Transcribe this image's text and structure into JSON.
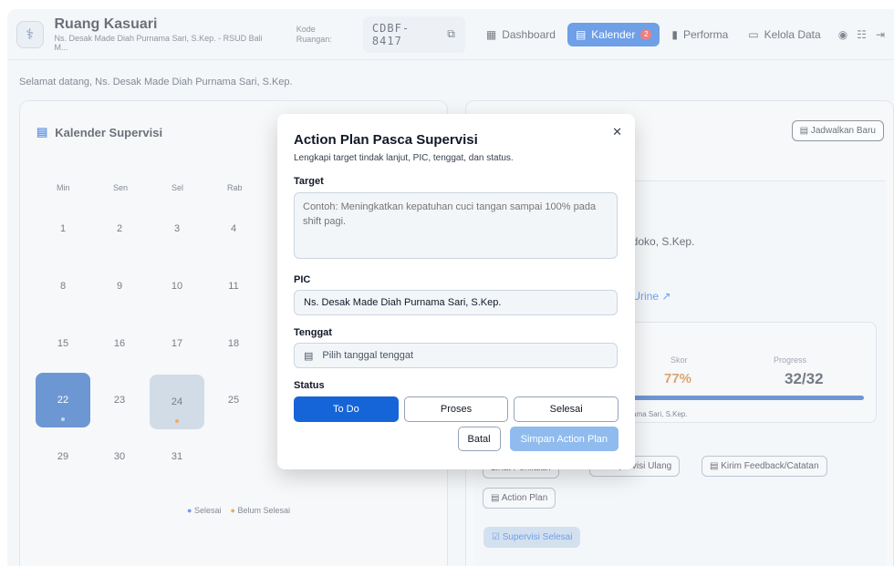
{
  "header": {
    "title": "Ruang Kasuari",
    "subtitle": "Ns. Desak Made Diah Purnama Sari, S.Kep. - RSUD Bali M...",
    "kode_label": "Kode Ruangan:",
    "kode_value": "CDBF-8417",
    "nav": [
      {
        "label": "Dashboard",
        "icon": "dashboard-icon"
      },
      {
        "label": "Kalender",
        "icon": "calendar-icon",
        "badge": "2"
      },
      {
        "label": "Performa",
        "icon": "chart-icon"
      },
      {
        "label": "Kelola Data",
        "icon": "database-icon"
      }
    ]
  },
  "welcome": "Selamat datang, Ns. Desak Made Diah Purnama Sari, S.Kep.",
  "calendar": {
    "title": "Kalender Supervisi",
    "days_of_week": [
      "Min",
      "Sen",
      "Sel",
      "Rab"
    ],
    "weeks": [
      [
        "1",
        "2",
        "3",
        "4"
      ],
      [
        "8",
        "9",
        "10",
        "11"
      ],
      [
        "15",
        "16",
        "17",
        "18"
      ],
      [
        "22",
        "23",
        "24",
        "25"
      ],
      [
        "29",
        "30",
        "31",
        ""
      ]
    ],
    "legend_done": "Selesai",
    "legend_pending": "Belum Selesai"
  },
  "detail": {
    "schedule_button": "Jadwalkan Baru",
    "nurse_partial": "ndoko, S.Kep.",
    "link_partial": "r Urine",
    "score_label": "Skor",
    "score_value": "77%",
    "progress_label": "Progress",
    "progress_value": "32/32",
    "progress_fraction": 1.0,
    "pic_partial": "rnama Sari, S.Kep.",
    "btn_view": "Lihat Penilaian",
    "btn_resupervise": "Supervisi Ulang",
    "btn_feedback": "Kirim Feedback/Catatan",
    "btn_action_plan": "Action Plan",
    "btn_done": "Supervisi Selesai"
  },
  "modal": {
    "title": "Action Plan Pasca Supervisi",
    "subtitle": "Lengkapi target tindak lanjut, PIC, tenggat, dan status.",
    "target_label": "Target",
    "target_placeholder": "Contoh: Meningkatkan kepatuhan cuci tangan sampai 100% pada shift pagi.",
    "pic_label": "PIC",
    "pic_value": "Ns. Desak Made Diah Purnama Sari, S.Kep.",
    "deadline_label": "Tenggat",
    "deadline_placeholder": "Pilih tanggal tenggat",
    "status_label": "Status",
    "status_options": [
      "To Do",
      "Proses",
      "Selesai"
    ],
    "status_selected": "To Do",
    "cancel": "Batal",
    "save": "Simpan Action Plan"
  },
  "colors": {
    "accent": "#1565d8",
    "score": "#c56d1a",
    "pending_dot": "#e67700",
    "badge": "#e03131"
  }
}
